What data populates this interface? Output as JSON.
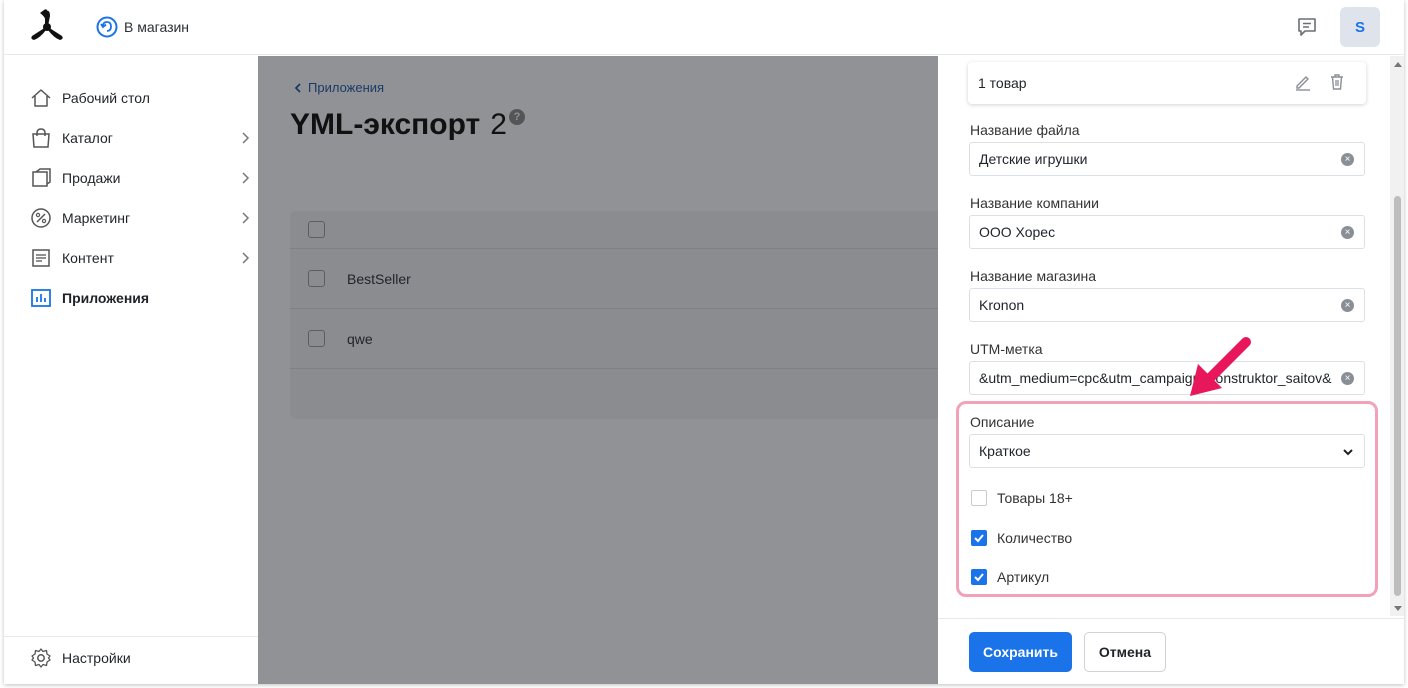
{
  "header": {
    "back_to_store_label": "В магазин",
    "avatar_initial": "S"
  },
  "sidebar": {
    "items": [
      {
        "label": "Рабочий стол",
        "icon": "home-icon"
      },
      {
        "label": "Каталог",
        "icon": "bag-icon"
      },
      {
        "label": "Продажи",
        "icon": "sales-icon"
      },
      {
        "label": "Маркетинг",
        "icon": "percent-icon"
      },
      {
        "label": "Контент",
        "icon": "document-icon"
      },
      {
        "label": "Приложения",
        "icon": "apps-chart-icon"
      }
    ],
    "settings_label": "Настройки"
  },
  "main": {
    "breadcrumb": "Приложения",
    "title": "YML-экспорт",
    "count": "2",
    "help": "?",
    "rows": [
      "BestSeller",
      "qwe"
    ]
  },
  "drawer": {
    "product_card": "1 товар",
    "fields": [
      {
        "label": "Название файла",
        "value": "Детские игрушки"
      },
      {
        "label": "Название компании",
        "value": "ООО Хорес"
      },
      {
        "label": "Название магазина",
        "value": "Kronon"
      },
      {
        "label": "UTM-метка",
        "value": "&utm_medium=cpc&utm_campaign=konstruktor_saitov&"
      }
    ],
    "description": {
      "label": "Описание",
      "value": "Краткое"
    },
    "checkboxes": [
      {
        "label": "Товары 18+",
        "checked": false
      },
      {
        "label": "Количество",
        "checked": true
      },
      {
        "label": "Артикул",
        "checked": true
      }
    ],
    "save_label": "Сохранить",
    "cancel_label": "Отмена"
  },
  "colors": {
    "accent": "#1a73e8",
    "overlay": "#919296",
    "highlight_border": "#f2a2b8",
    "arrow": "#e8165a"
  }
}
